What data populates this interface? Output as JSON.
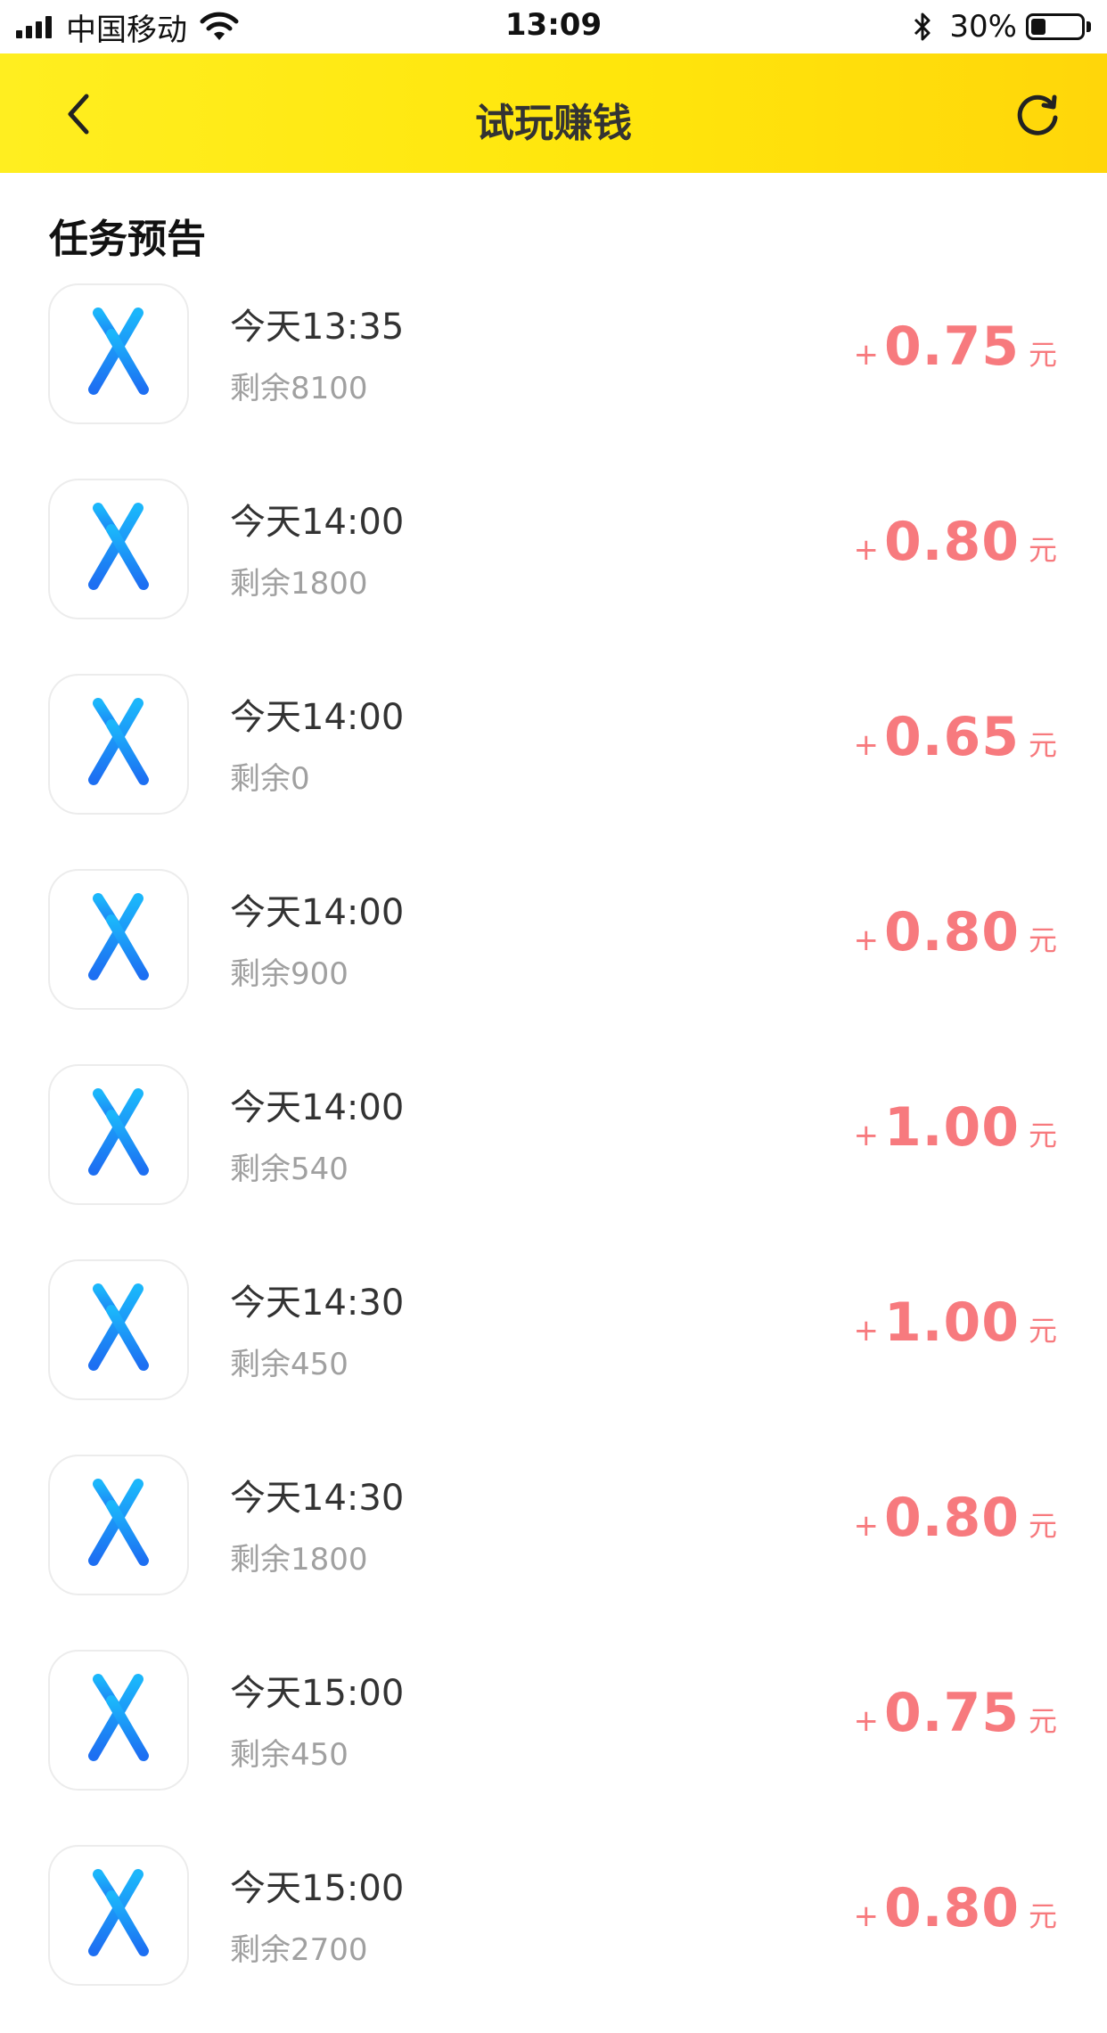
{
  "status_bar": {
    "carrier": "中国移动",
    "time": "13:09",
    "battery": "30%",
    "battery_level": 0.3
  },
  "header": {
    "title": "试玩赚钱",
    "back_icon": "chevron-left-icon",
    "refresh_icon": "refresh-icon",
    "bg_color_start": "#ffee20",
    "bg_color_end": "#ffd60a"
  },
  "section": {
    "title": "任务预告"
  },
  "accent_color": "#f77a7e",
  "tasks": [
    {
      "time": "今天13:35",
      "remain": "剩余8100",
      "plus": "+",
      "amount": "0.75",
      "unit": "元",
      "icon": "app-store-icon"
    },
    {
      "time": "今天14:00",
      "remain": "剩余1800",
      "plus": "+",
      "amount": "0.80",
      "unit": "元",
      "icon": "app-store-icon"
    },
    {
      "time": "今天14:00",
      "remain": "剩余0",
      "plus": "+",
      "amount": "0.65",
      "unit": "元",
      "icon": "app-store-icon"
    },
    {
      "time": "今天14:00",
      "remain": "剩余900",
      "plus": "+",
      "amount": "0.80",
      "unit": "元",
      "icon": "app-store-icon"
    },
    {
      "time": "今天14:00",
      "remain": "剩余540",
      "plus": "+",
      "amount": "1.00",
      "unit": "元",
      "icon": "app-store-icon"
    },
    {
      "time": "今天14:30",
      "remain": "剩余450",
      "plus": "+",
      "amount": "1.00",
      "unit": "元",
      "icon": "app-store-icon"
    },
    {
      "time": "今天14:30",
      "remain": "剩余1800",
      "plus": "+",
      "amount": "0.80",
      "unit": "元",
      "icon": "app-store-icon"
    },
    {
      "time": "今天15:00",
      "remain": "剩余450",
      "plus": "+",
      "amount": "0.75",
      "unit": "元",
      "icon": "app-store-icon"
    },
    {
      "time": "今天15:00",
      "remain": "剩余2700",
      "plus": "+",
      "amount": "0.80",
      "unit": "元",
      "icon": "app-store-icon"
    }
  ]
}
